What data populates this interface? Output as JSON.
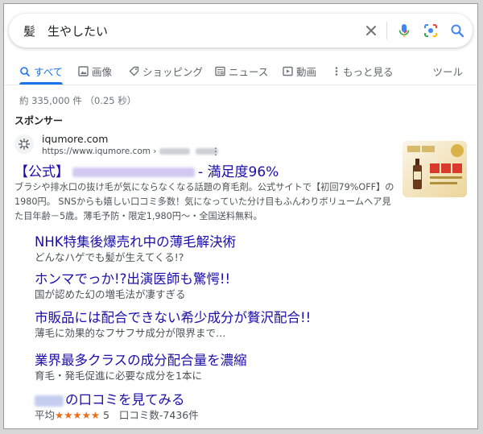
{
  "search": {
    "query": "髪　生やしたい"
  },
  "tabs": [
    {
      "label": "すべて",
      "icon": "search-icon",
      "active": true
    },
    {
      "label": "画像",
      "icon": "image-icon"
    },
    {
      "label": "ショッピング",
      "icon": "tag-icon"
    },
    {
      "label": "ニュース",
      "icon": "news-icon"
    },
    {
      "label": "動画",
      "icon": "video-icon"
    },
    {
      "label": "もっと見る",
      "icon": "more-vert-icon"
    }
  ],
  "tools_label": "ツール",
  "stats": "約 335,000 件 （0.25 秒）",
  "sponsored_label": "スポンサー",
  "ad": {
    "site_name": "iqumore.com",
    "site_url": "https://www.iqumore.com ›",
    "title_prefix": "【公式】",
    "title_suffix": "- 満足度96%",
    "description": "ブラシや排水口の抜け毛が気にならなくなる話題の育毛剤。公式サイトで【初回79%OFF】の1980円。 SNSからも嬉しい口コミ多数！気になっていた分け目もふんわりボリュームヘア見た目年齢－5歳。薄毛予防・限定1,980円～・全国送料無料。"
  },
  "sitelinks": [
    {
      "title": "NHK特集後爆売れ中の薄毛解決術",
      "desc": "どんなハゲでも髪が生えてくる!?"
    },
    {
      "title": "ホンマでっか!?出演医師も驚愕!!",
      "desc": "国が認めた幻の増毛法が凄すぎる"
    },
    {
      "title": "市販品には配合できない希少成分が贅沢配合!!",
      "desc": "薄毛に効果的なフサフサ成分が限界まで…"
    },
    {
      "title": "業界最多クラスの成分配合量を濃縮",
      "desc": "育毛・発毛促進に必要な成分を1本に"
    },
    {
      "title_suffix": "の口コミを見てみる",
      "rating_prefix": "平均",
      "stars": "★★★★★",
      "rating_value": "5",
      "review_count": "口コミ数-7436件"
    }
  ],
  "colors": {
    "link": "#1a0dab",
    "accent": "#1a73e8",
    "star": "#e7711b"
  }
}
